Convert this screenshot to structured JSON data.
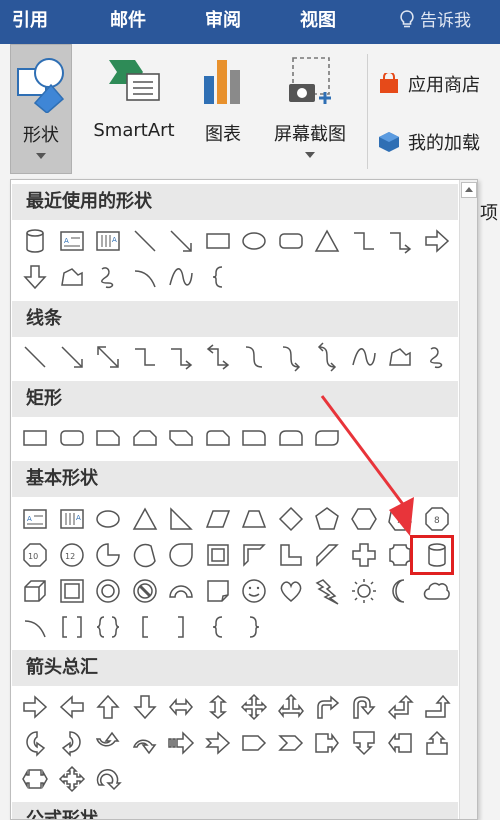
{
  "tabs": [
    {
      "label": "引用"
    },
    {
      "label": "邮件"
    },
    {
      "label": "审阅"
    },
    {
      "label": "视图"
    }
  ],
  "tell_me": "告诉我",
  "ribbon": {
    "shapes_label": "形状",
    "smartart_label": "SmartArt",
    "chart_label": "图表",
    "screenshot_label": "屏幕截图",
    "store_label": "应用商店",
    "addins_label": "我的加载",
    "partial_label": "项"
  },
  "sections": {
    "recent": "最近使用的形状",
    "lines": "线条",
    "rectangles": "矩形",
    "basic": "基本形状",
    "arrows": "箭头总汇",
    "equation": "公式形状"
  },
  "shape_rows": {
    "recent_1": [
      "cylinder",
      "text-box",
      "vertical-text-box",
      "line",
      "line-arrow",
      "rectangle",
      "oval",
      "rounded-rectangle",
      "triangle",
      "elbow-connector",
      "elbow-arrow-connector",
      "right-arrow"
    ],
    "recent_2": [
      "down-arrow",
      "freeform",
      "scribble",
      "arc",
      "curve",
      "left-brace"
    ],
    "lines_1": [
      "line",
      "line-arrow",
      "double-arrow-line",
      "elbow-connector",
      "elbow-arrow-connector",
      "elbow-double-arrow",
      "curved-connector",
      "curved-arrow-connector",
      "curved-double-arrow",
      "curve",
      "freeform",
      "scribble"
    ],
    "rect_1": [
      "rectangle",
      "rounded-rectangle",
      "snip-single-corner",
      "snip-same-side",
      "snip-diagonal",
      "snip-round",
      "round-single-corner",
      "round-same-side",
      "round-diagonal"
    ],
    "basic_1": [
      "text-box",
      "vertical-text-box",
      "oval",
      "isosceles-triangle",
      "right-triangle",
      "parallelogram",
      "trapezoid",
      "diamond",
      "pentagon",
      "hexagon",
      "heptagon",
      "octagon"
    ],
    "basic_2": [
      "decagon",
      "dodecagon",
      "pie",
      "chord",
      "teardrop",
      "frame",
      "half-frame",
      "l-shape",
      "diagonal-stripe",
      "cross",
      "plaque",
      "can"
    ],
    "basic_3": [
      "cube",
      "bevel",
      "donut",
      "no-symbol",
      "block-arc",
      "folded-corner",
      "smiley-face",
      "heart",
      "lightning-bolt",
      "sun",
      "moon",
      "cloud"
    ],
    "basic_4": [
      "arc",
      "double-bracket",
      "double-brace",
      "left-bracket",
      "right-bracket",
      "left-brace",
      "right-brace"
    ],
    "arrows_1": [
      "right-arrow",
      "left-arrow",
      "up-arrow",
      "down-arrow",
      "left-right-arrow",
      "up-down-arrow",
      "quad-arrow",
      "left-right-up-arrow",
      "bent-arrow",
      "u-turn-arrow",
      "left-up-arrow",
      "bent-up-arrow"
    ],
    "arrows_2": [
      "curved-right-arrow",
      "curved-left-arrow",
      "curved-up-arrow",
      "curved-down-arrow",
      "striped-right-arrow",
      "notched-right-arrow",
      "pentagon-arrow",
      "chevron",
      "right-arrow-callout",
      "down-arrow-callout",
      "left-arrow-callout",
      "up-arrow-callout"
    ],
    "arrows_3": [
      "left-right-arrow-callout",
      "quad-arrow-callout",
      "circular-arrow"
    ]
  },
  "highlighted_shape": "can",
  "colors": {
    "tab_bar": "#2b579a",
    "highlight": "#e02020",
    "arrow": "#e8343a"
  }
}
